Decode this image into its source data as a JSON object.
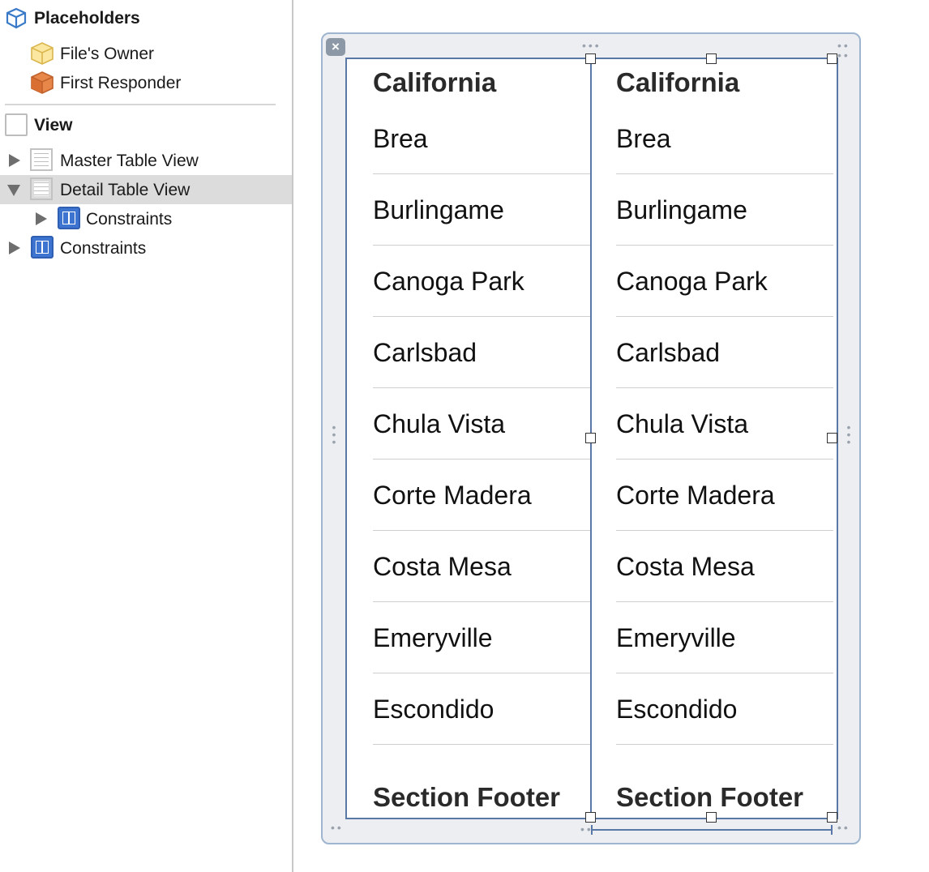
{
  "outline": {
    "placeholders_label": "Placeholders",
    "files_owner": "File's Owner",
    "first_responder": "First Responder",
    "view_label": "View",
    "master_table_view": "Master Table View",
    "detail_table_view": "Detail Table View",
    "detail_constraints": "Constraints",
    "view_constraints": "Constraints",
    "selected_item": "Detail Table View"
  },
  "canvas": {
    "columns": [
      {
        "header": "California",
        "cells": [
          "Brea",
          "Burlingame",
          "Canoga Park",
          "Carlsbad",
          "Chula Vista",
          "Corte Madera",
          "Costa Mesa",
          "Emeryville",
          "Escondido"
        ],
        "footer": "Section Footer"
      },
      {
        "header": "California",
        "cells": [
          "Brea",
          "Burlingame",
          "Canoga Park",
          "Carlsbad",
          "Chula Vista",
          "Corte Madera",
          "Costa Mesa",
          "Emeryville",
          "Escondido"
        ],
        "footer": "Section Footer"
      }
    ]
  },
  "colors": {
    "selection": "#dcdcdc",
    "constraint_icon": "#3d74cf",
    "frame_border": "#9fb5cf",
    "view_border": "#5a78a6"
  }
}
